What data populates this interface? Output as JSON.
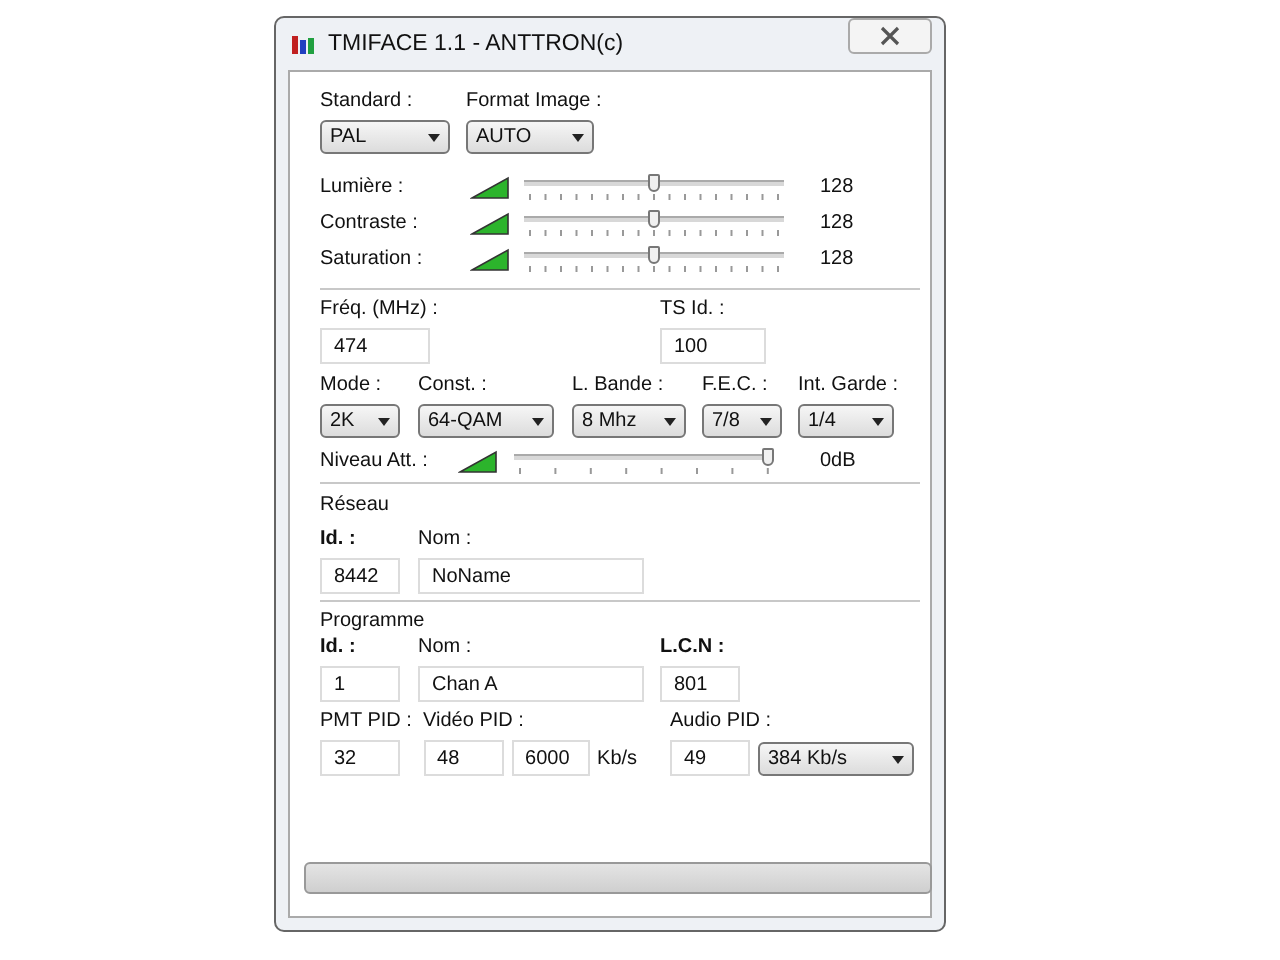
{
  "window": {
    "title": "TMIFACE 1.1 - ANTTRON(c)"
  },
  "image": {
    "standard": {
      "label": "Standard :",
      "value": "PAL"
    },
    "format": {
      "label": "Format Image :",
      "value": "AUTO"
    }
  },
  "picture_sliders": [
    {
      "label": "Lumière :",
      "level": 0.5,
      "reading": "128"
    },
    {
      "label": "Contraste :",
      "level": 0.5,
      "reading": "128"
    },
    {
      "label": "Saturation :",
      "level": 0.5,
      "reading": "128"
    }
  ],
  "tuning": {
    "frequency": {
      "label": "Fréq. (MHz) :",
      "value": "474"
    },
    "ts_id": {
      "label": "TS Id. :",
      "value": "100"
    },
    "combos": [
      {
        "label": "Mode :",
        "value": "2K"
      },
      {
        "label": "Const. :",
        "value": "64-QAM"
      },
      {
        "label": "L. Bande :",
        "value": "8 Mhz"
      },
      {
        "label": "F.E.C. :",
        "value": "7/8"
      },
      {
        "label": "Int. Garde :",
        "value": "1/4"
      }
    ],
    "attenuation": {
      "label": "Niveau Att. :",
      "level": 1,
      "reading": "0dB"
    }
  },
  "network": {
    "title": "Réseau",
    "id": {
      "label": "Id. :",
      "value": "8442"
    },
    "name": {
      "label": "Nom :",
      "value": "NoName"
    }
  },
  "program": {
    "title": "Programme",
    "id": {
      "label": "Id. :",
      "value": "1"
    },
    "name": {
      "label": "Nom :",
      "value": "Chan A"
    },
    "lcn": {
      "label": "L.C.N :",
      "value": "801"
    },
    "pmt_pid": {
      "label": "PMT PID :",
      "value": "32"
    },
    "video_pid": {
      "label": "Vidéo PID :",
      "value": "48",
      "rate": "6000",
      "unit": "Kb/s"
    },
    "audio_pid": {
      "label": "Audio PID :",
      "value": "49",
      "rate": "384 Kb/s"
    }
  }
}
